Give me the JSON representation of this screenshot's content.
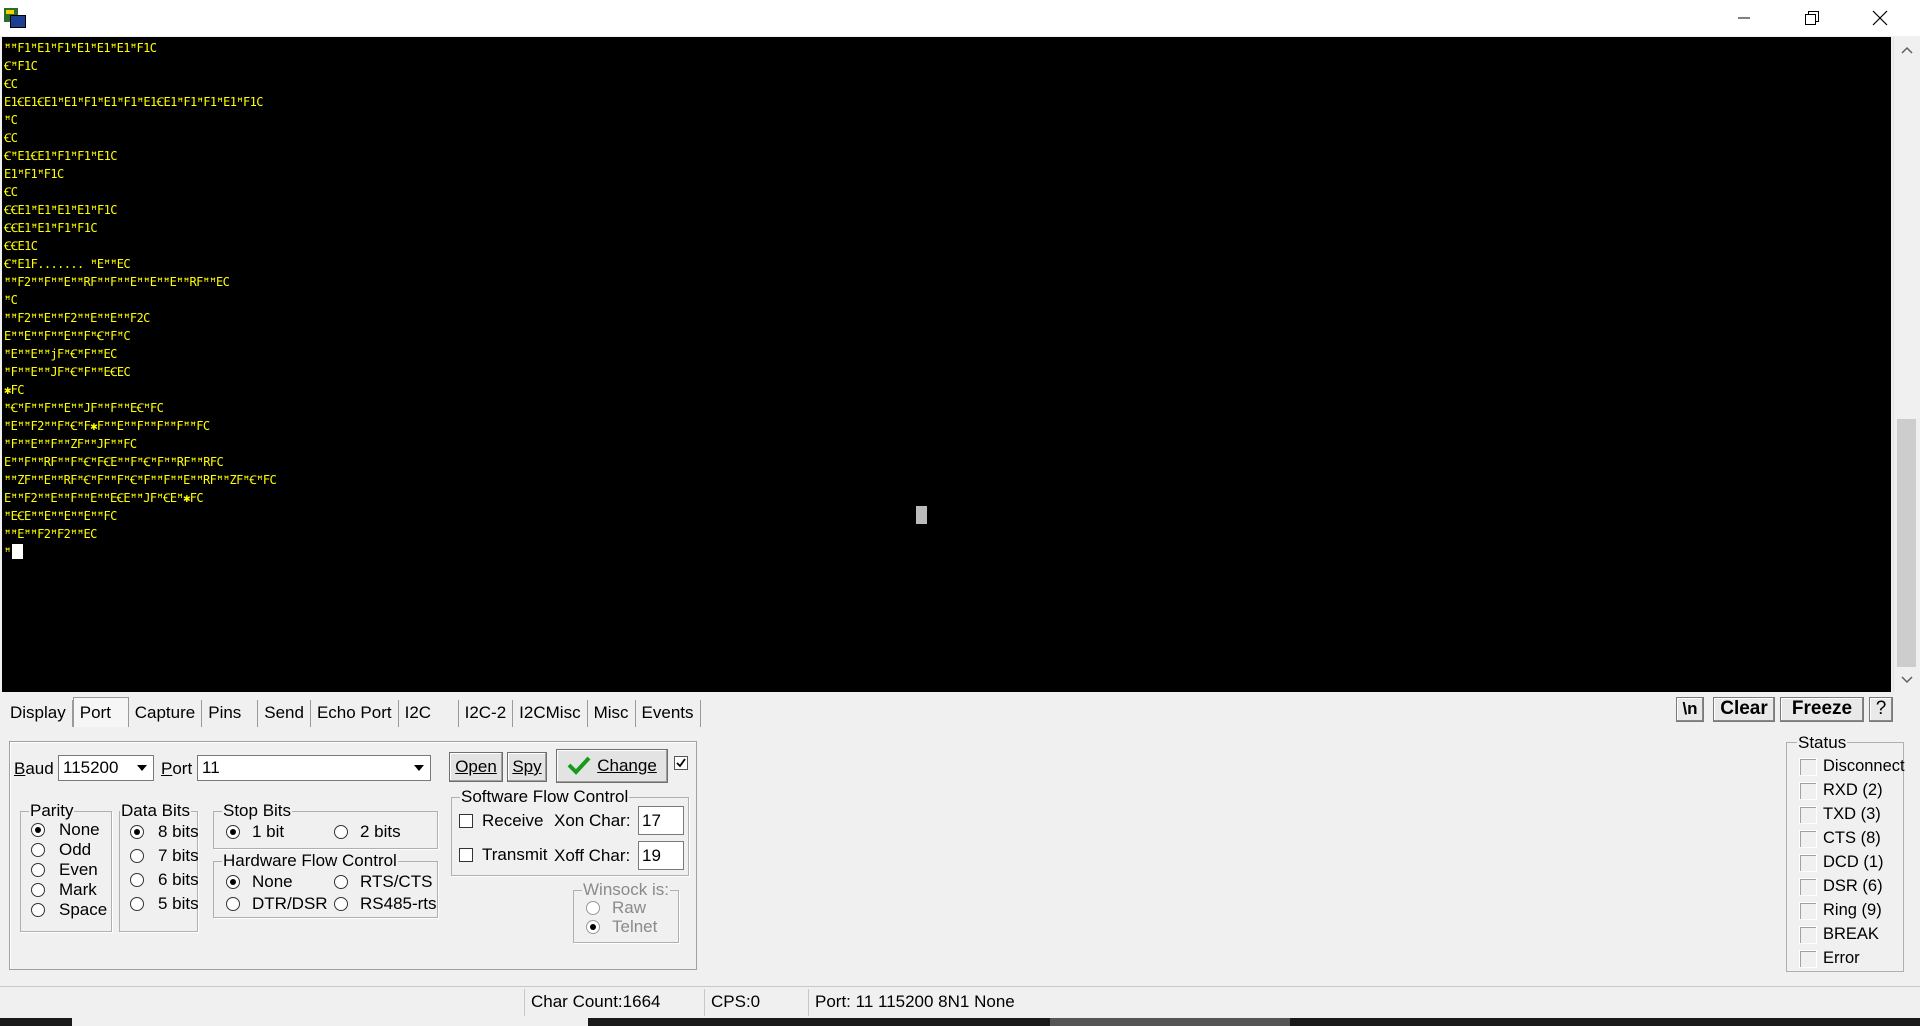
{
  "window": {
    "app_icon": "terminal-app-icon",
    "controls": {
      "minimize": "minimize-icon",
      "restore": "restore-icon",
      "close": "close-icon"
    }
  },
  "terminal": {
    "lines": [
      "ꟸꟸF1ꟸE1ꟸF1ꟸE1ꟸE1ꟸE1ꟸF1C",
      "ꞒꟸF1C",
      "ꞒC",
      "E1ꞒE1ꞒE1ꟸE1ꟸF1ꟸE1ꟸF1ꟸE1ꞒE1ꟸF1ꟸF1ꟸE1ꟸF1C",
      "ꟸC",
      "ꞒC",
      "ꞒꟸE1ꞒE1ꟸF1ꟸF1ꟸE1C",
      "E1ꟸF1ꟸF1C",
      "ꞒC",
      "ꞒꞒE1ꟸE1ꟸE1ꟸE1ꟸF1C",
      "ꞒꞒE1ꟸE1ꟸF1ꟸF1C",
      "ꞒꞒE1C",
      "ꞒꟸE1F....... ꟸEꟸꟸEC",
      "ꟸꟸF2ꟸꟸFꟸꟸEꟸꟸRFꟸꟸFꟸꟸEꟸꟸEꟸꟸEꟸꟸRFꟸꟸEC",
      "ꟸC",
      "ꟸꟸF2ꟸꟸEꟸꟸF2ꟸꟸEꟸꟸEꟸꟸF2C",
      "EꟸꟸEꟸꟸFꟸꟸEꟸꟸFꟸꞒꟸFꟸC",
      "ꟸEꟸꟸEꟸꟸjFꟸꞒꟸFꟸꟸEC",
      "ꟸFꟸꟸEꟸꟸJFꟸꞒꟸFꟸꟸEꞒEC",
      "✱FC",
      "ꟸꞒꟸFꟸꟸFꟸꟸEꟸꟸJFꟸꟸFꟸꟸEꞒꟸFC",
      "ꟸEꟸꟸF2ꟸꟸFꟸꞒꟸF✱FꟸꟸEꟸꟸFꟸꟸFꟸꟸFꟸꟸFC",
      "ꟸFꟸꟸEꟸꟸFꟸꟸZFꟸꟸJFꟸꟸFC",
      "EꟸꟸFꟸꟸRFꟸꟸFꟸꞒꟸFꞒEꟸꟸFꟸꞒꟸFꟸꟸRFꟸꟸRFC",
      "ꟸꟸZFꟸꟸEꟸꟸRFꟸꞒꟸFꟸꟸFꟸꞒꟸFꟸꟸFꟸꟸEꟸꟸRFꟸꟸZFꟸꞒꟸFC",
      "EꟸꟸF2ꟸꟸEꟸꟸFꟸꟸEꟸꟸEꞒEꟸꟸJFꟸꞒEꟸ✱FC",
      "ꟸEꞒEꟸꟸEꟸꟸEꟸꟸEꟸꟸFC",
      "ꟸꟸEꟸꟸF2ꟸF2ꟸꟸEC",
      "ꟸ"
    ]
  },
  "tabs": [
    {
      "label": "Display",
      "active": false
    },
    {
      "label": "Port",
      "active": true
    },
    {
      "label": "Capture",
      "active": false
    },
    {
      "label": "Pins",
      "active": false
    },
    {
      "label": "Send",
      "active": false
    },
    {
      "label": "Echo Port",
      "active": false
    },
    {
      "label": "I2C",
      "active": false
    },
    {
      "label": "I2C-2",
      "active": false
    },
    {
      "label": "I2CMisc",
      "active": false
    },
    {
      "label": "Misc",
      "active": false
    },
    {
      "label": "Events",
      "active": false
    }
  ],
  "toolbar": {
    "newline": "\\n",
    "clear": "Clear",
    "freeze": "Freeze",
    "help": "?"
  },
  "port": {
    "baud_label": "Baud",
    "baud_value": "115200",
    "port_label": "Port",
    "port_value": "11",
    "open": "Open",
    "spy": "Spy",
    "change": "Change",
    "parity": {
      "title": "Parity",
      "options": [
        "None",
        "Odd",
        "Even",
        "Mark",
        "Space"
      ],
      "selected": "None"
    },
    "data_bits": {
      "title": "Data Bits",
      "options": [
        "8 bits",
        "7 bits",
        "6 bits",
        "5 bits"
      ],
      "selected": "8 bits"
    },
    "stop_bits": {
      "title": "Stop Bits",
      "options": [
        "1 bit",
        "2 bits"
      ],
      "selected": "1 bit"
    },
    "hw_flow": {
      "title": "Hardware Flow Control",
      "options": [
        "None",
        "RTS/CTS",
        "DTR/DSR",
        "RS485-rts"
      ],
      "selected": "None"
    },
    "sw_flow": {
      "title": "Software Flow Control",
      "receive": "Receive",
      "transmit": "Transmit",
      "xon_label": "Xon Char:",
      "xon_value": "17",
      "xoff_label": "Xoff Char:",
      "xoff_value": "19"
    },
    "winsock": {
      "title": "Winsock is:",
      "options": [
        "Raw",
        "Telnet"
      ],
      "selected": "Telnet"
    }
  },
  "status": {
    "title": "Status",
    "items": [
      "Disconnect",
      "RXD (2)",
      "TXD (3)",
      "CTS (8)",
      "DCD (1)",
      "DSR (6)",
      "Ring (9)",
      "BREAK",
      "Error"
    ]
  },
  "statusbar": {
    "char_count": "Char Count:1664",
    "cps": "CPS:0",
    "port_info": "Port: 11 115200 8N1 None"
  },
  "colors": {
    "terminal_bg": "#000000",
    "terminal_fg": "#ffff00",
    "change_check": "#1a9a1a"
  }
}
